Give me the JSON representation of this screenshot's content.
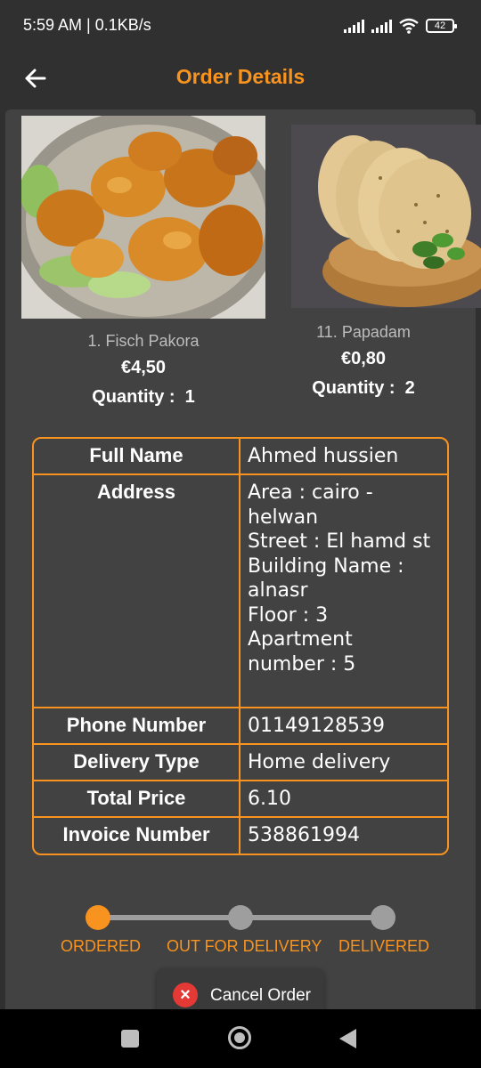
{
  "status_bar": {
    "time_speed": "5:59 AM | 0.1KB/s",
    "battery": "42"
  },
  "header": {
    "title": "Order Details"
  },
  "products": [
    {
      "name": "1. Fisch Pakora",
      "price": "€4,50",
      "quantity_label": "Quantity :",
      "quantity": "1"
    },
    {
      "name": "11. Papadam",
      "price": "€0,80",
      "quantity_label": "Quantity :",
      "quantity": "2"
    }
  ],
  "details": {
    "full_name_label": "Full Name",
    "full_name": "Ahmed hussien",
    "address_label": "Address",
    "address_lines": [
      "Area : cairo -",
      "helwan",
      "Street : El hamd st",
      "Building Name :",
      "alnasr",
      "Floor : 3",
      "Apartment",
      "number : 5"
    ],
    "phone_label": "Phone Number",
    "phone": "01149128539",
    "delivery_type_label": "Delivery Type",
    "delivery_type": "Home delivery",
    "total_price_label": "Total Price",
    "total_price": "6.10",
    "invoice_label": "Invoice Number",
    "invoice": "538861994"
  },
  "progress": {
    "steps": [
      "ORDERED",
      "OUT FOR DELIVERY",
      "DELIVERED"
    ],
    "current_step": 1,
    "active_color": "#f7931e",
    "inactive_color": "#9e9e9e"
  },
  "actions": {
    "cancel_label": "Cancel Order"
  },
  "colors": {
    "accent": "#f7931e",
    "background": "#303030",
    "card": "#424242",
    "danger": "#e53935"
  }
}
